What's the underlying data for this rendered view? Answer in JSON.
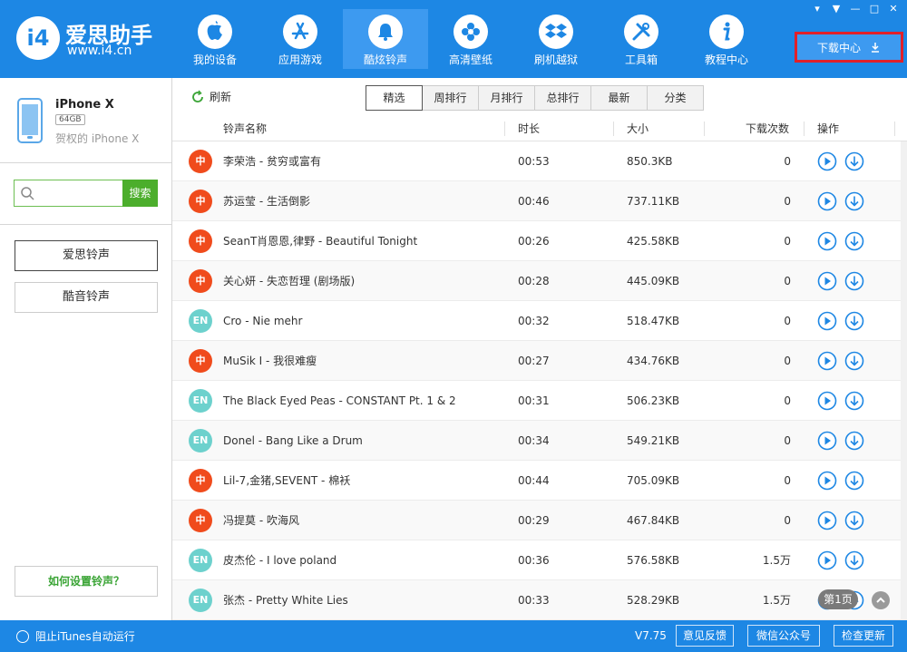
{
  "app": {
    "name": "爱思助手",
    "site": "www.i4.cn",
    "logo_text": "i4"
  },
  "nav": [
    {
      "label": "我的设备",
      "icon": "apple-icon"
    },
    {
      "label": "应用游戏",
      "icon": "app-store-icon"
    },
    {
      "label": "酷炫铃声",
      "icon": "bell-icon"
    },
    {
      "label": "高清壁纸",
      "icon": "flower-icon"
    },
    {
      "label": "刷机越狱",
      "icon": "dropbox-icon"
    },
    {
      "label": "工具箱",
      "icon": "tools-icon"
    },
    {
      "label": "教程中心",
      "icon": "info-icon"
    }
  ],
  "download_center": "下载中心",
  "device": {
    "name": "iPhone X",
    "capacity": "64GB",
    "owner": "贺权的 iPhone X"
  },
  "search": {
    "button": "搜索",
    "placeholder": ""
  },
  "sidebar": {
    "items": [
      "爱思铃声",
      "酷音铃声"
    ],
    "help": "如何设置铃声？"
  },
  "toolbar": {
    "refresh": "刷新",
    "tabs": [
      "精选",
      "周排行",
      "月排行",
      "总排行",
      "最新",
      "分类"
    ]
  },
  "table": {
    "columns": {
      "name": "铃声名称",
      "duration": "时长",
      "size": "大小",
      "downloads": "下载次数",
      "actions": "操作"
    },
    "rows": [
      {
        "lang": "中",
        "type": "zh",
        "name": "李荣浩 - 贫穷或富有",
        "duration": "00:53",
        "size": "850.3KB",
        "downloads": "0"
      },
      {
        "lang": "中",
        "type": "zh",
        "name": "苏运莹 - 生活倒影",
        "duration": "00:46",
        "size": "737.11KB",
        "downloads": "0"
      },
      {
        "lang": "中",
        "type": "zh",
        "name": "SeanT肖恩恩,律野 - Beautiful Tonight",
        "duration": "00:26",
        "size": "425.58KB",
        "downloads": "0"
      },
      {
        "lang": "中",
        "type": "zh",
        "name": "关心妍 - 失恋哲理 (剧场版)",
        "duration": "00:28",
        "size": "445.09KB",
        "downloads": "0"
      },
      {
        "lang": "EN",
        "type": "en",
        "name": "Cro - Nie mehr",
        "duration": "00:32",
        "size": "518.47KB",
        "downloads": "0"
      },
      {
        "lang": "中",
        "type": "zh",
        "name": "MuSik I - 我很难瘦",
        "duration": "00:27",
        "size": "434.76KB",
        "downloads": "0"
      },
      {
        "lang": "EN",
        "type": "en",
        "name": "The Black Eyed Peas - CONSTANT Pt. 1 & 2",
        "duration": "00:31",
        "size": "506.23KB",
        "downloads": "0"
      },
      {
        "lang": "EN",
        "type": "en",
        "name": "Donel - Bang Like a Drum",
        "duration": "00:34",
        "size": "549.21KB",
        "downloads": "0"
      },
      {
        "lang": "中",
        "type": "zh",
        "name": "Lil-7,金猪,SEVENT - 棉袄",
        "duration": "00:44",
        "size": "705.09KB",
        "downloads": "0"
      },
      {
        "lang": "中",
        "type": "zh",
        "name": "冯提莫 - 吹海风",
        "duration": "00:29",
        "size": "467.84KB",
        "downloads": "0"
      },
      {
        "lang": "EN",
        "type": "en",
        "name": "皮杰伦 - I love poland",
        "duration": "00:36",
        "size": "576.58KB",
        "downloads": "1.5万"
      },
      {
        "lang": "EN",
        "type": "en",
        "name": "张杰 - Pretty White Lies",
        "duration": "00:33",
        "size": "528.29KB",
        "downloads": "1.5万"
      }
    ]
  },
  "pager": {
    "label": "第1页"
  },
  "status": {
    "itunes": "阻止iTunes自动运行",
    "version": "V7.75",
    "feedback": "意见反馈",
    "wechat": "微信公众号",
    "update": "检查更新"
  },
  "colors": {
    "brand": "#1d87e4",
    "zh_badge": "#f04b1c",
    "en_badge": "#6dd1cd",
    "search_green": "#4cae2c",
    "highlight_red": "#e0202a"
  }
}
